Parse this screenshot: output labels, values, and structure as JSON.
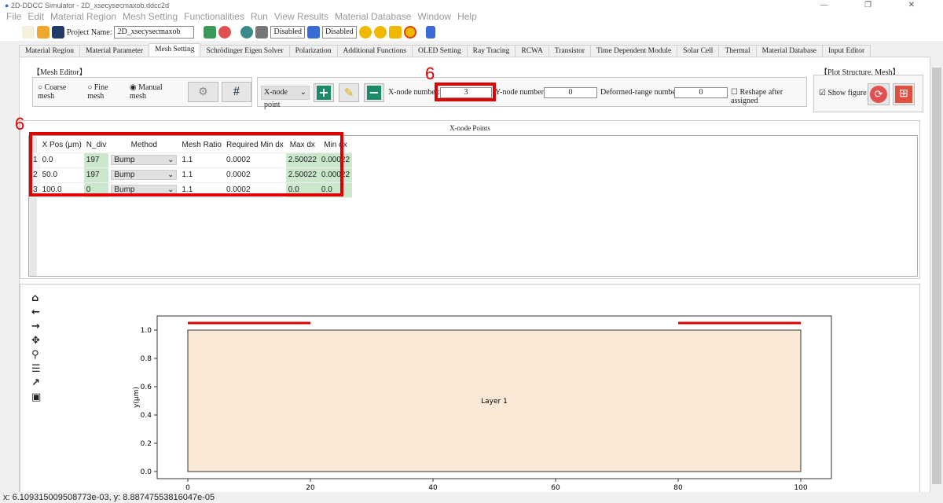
{
  "window": {
    "title": "2D-DDCC Simulator - 2D_xsecysecmaxob.ddcc2d",
    "controls": "— ❐ ✕"
  },
  "menu": [
    "File",
    "Edit",
    "Material Region",
    "Mesh Setting",
    "Functionalities",
    "Run",
    "View Results",
    "Material Database",
    "Window",
    "Help"
  ],
  "toolbar": {
    "project_label": "Project Name:",
    "project_name": "2D_xsecysecmaxob",
    "disabled1": "Disabled",
    "disabled2": "Disabled"
  },
  "tabs": [
    "Material Region",
    "Material Parameter",
    "Mesh Setting",
    "Schrödinger Eigen Solver",
    "Polarization",
    "Additional Functions",
    "OLED Setting",
    "Ray Tracing",
    "RCWA",
    "Transistor",
    "Time Dependent Module",
    "Solar Cell",
    "Thermal",
    "Material Database",
    "Input Editor"
  ],
  "active_tab": "Mesh Setting",
  "mesh_editor": {
    "title": "【Mesh Editor】",
    "options": [
      "Coarse mesh",
      "Fine mesh",
      "Manual mesh"
    ],
    "selected": "Manual mesh",
    "node_select": "X-node point",
    "x_node_label": "X-node number:",
    "x_node_value": "3",
    "y_node_label": "Y-node number:",
    "y_node_value": "0",
    "deformed_label": "Deformed-range number:",
    "deformed_value": "0",
    "reshape_label": "Reshape after assigned",
    "reshape_checked": false
  },
  "plot_group": {
    "title": "【Plot Structure, Mesh】",
    "show_figure": "Show figure",
    "show_checked": true
  },
  "annotations": {
    "marker1": "6",
    "marker2": "6"
  },
  "table": {
    "title": "X-node Points",
    "headers": [
      "",
      "X Pos (µm)",
      "N_div",
      "Method",
      "Mesh Ratio",
      "Required Min dx",
      "Max dx",
      "Min dx"
    ],
    "rows": [
      [
        "1",
        "0.0",
        "197",
        "Bump",
        "1.1",
        "0.0002",
        "2.50022",
        "0.00022"
      ],
      [
        "2",
        "50.0",
        "197",
        "Bump",
        "1.1",
        "0.0002",
        "2.50022",
        "0.00022"
      ],
      [
        "3",
        "100.0",
        "0",
        "Bump",
        "1.1",
        "0.0002",
        "0.0",
        "0.0"
      ]
    ]
  },
  "chart_data": {
    "type": "diagram",
    "ylabel": "y(µm)",
    "xlim": [
      -5,
      105
    ],
    "ylim": [
      -0.05,
      1.1
    ],
    "xticks": [
      "0",
      "20",
      "40",
      "60",
      "80",
      "100"
    ],
    "yticks": [
      "0.0",
      "0.2",
      "0.4",
      "0.6",
      "0.8",
      "1.0"
    ],
    "region": {
      "label": "Layer 1",
      "x": [
        0,
        100
      ],
      "y": [
        0,
        1
      ],
      "color": "#fae9d6"
    },
    "contacts": [
      {
        "x": [
          0,
          20
        ],
        "y": 1.05,
        "color": "#dd0000"
      },
      {
        "x": [
          80,
          100
        ],
        "y": 1.05,
        "color": "#dd0000"
      }
    ]
  },
  "status": "x: 6.109315009508773e-03, y: 8.88747553816047e-05"
}
